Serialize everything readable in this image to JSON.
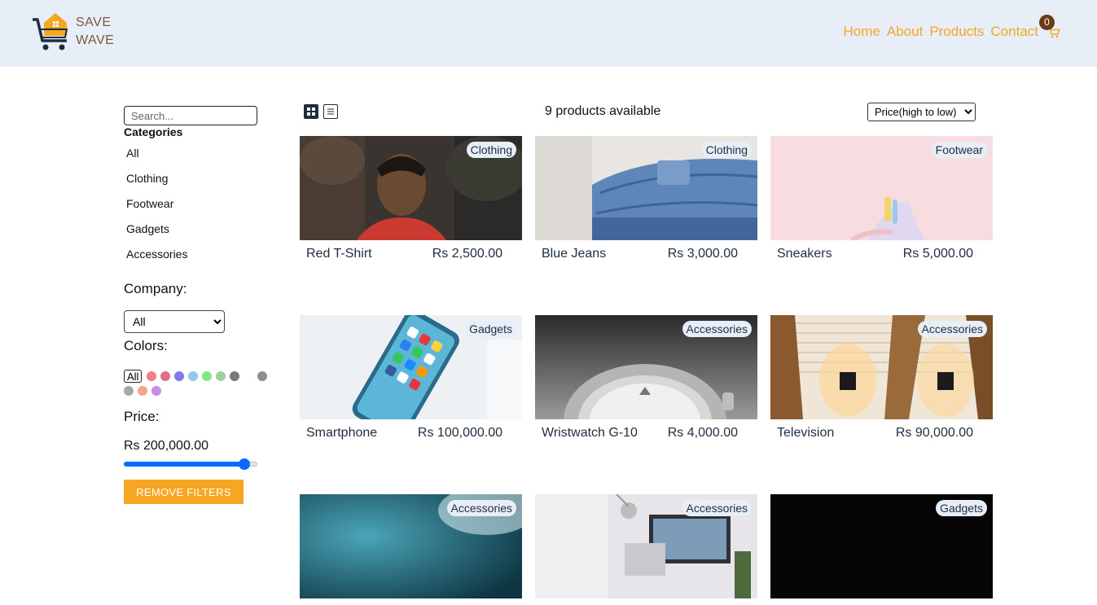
{
  "header": {
    "logo_line1": "SAVE",
    "logo_line2": "WAVE",
    "nav": [
      "Home",
      "About",
      "Products",
      "Contact"
    ],
    "cart_count": "0"
  },
  "sidebar": {
    "search_placeholder": "Search...",
    "categories_title": "Categories",
    "categories": [
      "All",
      "Clothing",
      "Footwear",
      "Gadgets",
      "Accessories"
    ],
    "company_title": "Company:",
    "company_selected": "All",
    "colors_title": "Colors:",
    "colors_all": "All",
    "colors": [
      "#f08080",
      "#e26d8a",
      "#7b7cf5",
      "#91c8f0",
      "#7fe87f",
      "#9fcf9f",
      "#7a7a7a",
      "#ffffff",
      "#8f8f8f",
      "#a8a8a8",
      "#f4a58a",
      "#c68ee6"
    ],
    "price_title": "Price:",
    "price_value": "Rs 200,000.00",
    "price_fraction": 0.9,
    "remove_filters": "REMOVE FILTERS"
  },
  "toolbar": {
    "count_text": "9 products available",
    "sort_selected": "Price(high to low)"
  },
  "products": [
    {
      "name": "Red T-Shirt",
      "price": "Rs 2,500.00",
      "category": "Clothing"
    },
    {
      "name": "Blue Jeans",
      "price": "Rs 3,000.00",
      "category": "Clothing"
    },
    {
      "name": "Sneakers",
      "price": "Rs 5,000.00",
      "category": "Footwear"
    },
    {
      "name": "Smartphone",
      "price": "Rs 100,000.00",
      "category": "Gadgets"
    },
    {
      "name": "Wristwatch G-10",
      "price": "Rs 4,000.00",
      "category": "Accessories"
    },
    {
      "name": "Television",
      "price": "Rs 90,000.00",
      "category": "Accessories"
    },
    {
      "name": "",
      "price": "",
      "category": "Accessories"
    },
    {
      "name": "",
      "price": "",
      "category": "Accessories"
    },
    {
      "name": "",
      "price": "",
      "category": "Gadgets"
    }
  ]
}
